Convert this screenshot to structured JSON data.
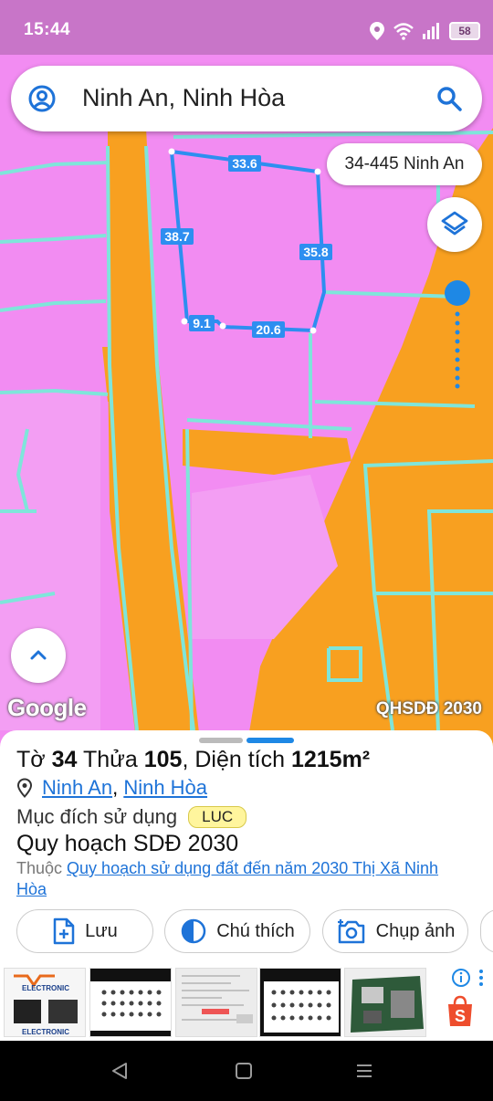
{
  "status_bar": {
    "time": "15:44",
    "battery": "58"
  },
  "search": {
    "query": "Ninh An, Ninh Hòa"
  },
  "address_chip": "34-445 Ninh An",
  "map": {
    "logo": "Google",
    "layer_label": "QHSDĐ 2030",
    "edge_labels": [
      "33.6",
      "38.7",
      "35.8",
      "9.1",
      "20.6"
    ],
    "colors": {
      "residential": "#f28cf2",
      "rice": "#f8a020",
      "boundary": "#7fe5da",
      "parcel": "#2e8ef0"
    }
  },
  "sheet": {
    "title_sheet_label": "Tờ",
    "title_sheet_number": "34",
    "title_parcel_label": "Thửa",
    "title_parcel_number": "105",
    "title_area_label": ", Diện tích",
    "title_area_value": "1215m²",
    "location_ward": "Ninh An",
    "location_sep": ",",
    "location_town": "Ninh Hòa",
    "purpose_label": "Mục đích sử dụng",
    "purpose_code": "LUC",
    "plan_title": "Quy hoạch SDĐ 2030",
    "belongs_prefix": "Thuộc",
    "belongs_link": "Quy hoạch sử dụng đất đến năm 2030 Thị Xã Ninh Hòa",
    "buttons": {
      "save": "Lưu",
      "legend": "Chú thích",
      "capture": "Chụp ảnh"
    },
    "ad_thumb_text": "ELECTRONIC"
  },
  "icons": [
    "account-icon",
    "search-icon",
    "layers-icon",
    "chevron-up-icon",
    "location-pin-icon",
    "add-file-icon",
    "contrast-icon",
    "camera-icon",
    "info-icon",
    "shopee-icon",
    "back-icon",
    "home-icon",
    "recents-icon"
  ]
}
